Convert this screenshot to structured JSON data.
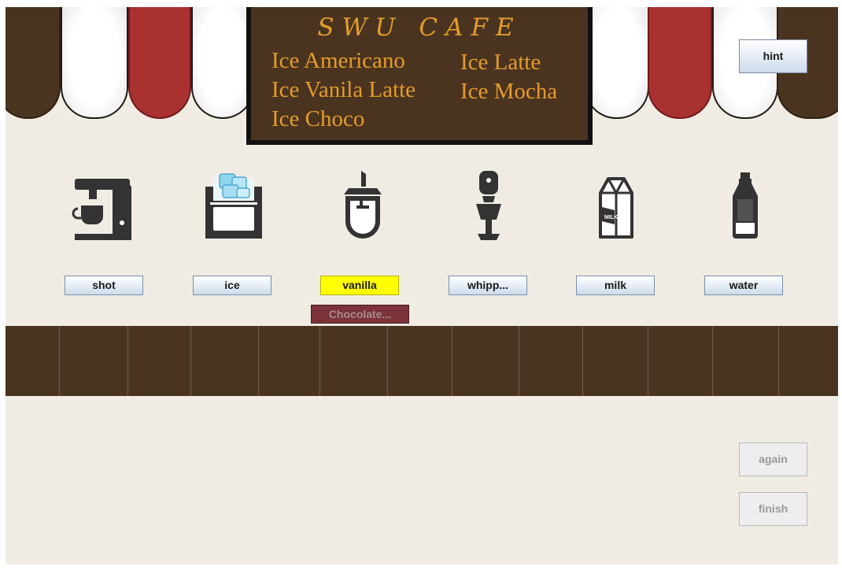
{
  "menu": {
    "title": "SWU CAFE",
    "items": [
      "Ice Americano",
      "Ice Latte",
      "Ice Vanila Latte",
      "Ice Mocha",
      "Ice Choco"
    ]
  },
  "buttons": {
    "hint": "hint",
    "again": "again",
    "finish": "finish",
    "chocolate": "Chocolate..."
  },
  "ingredients": [
    {
      "label": "shot",
      "icon": "espresso-machine-icon",
      "selected": false
    },
    {
      "label": "ice",
      "icon": "ice-machine-icon",
      "selected": false
    },
    {
      "label": "vanilla",
      "icon": "syrup-dispenser-icon",
      "selected": true
    },
    {
      "label": "whipp...",
      "icon": "hand-blender-icon",
      "selected": false
    },
    {
      "label": "milk",
      "icon": "milk-carton-icon",
      "selected": false
    },
    {
      "label": "water",
      "icon": "water-bottle-icon",
      "selected": false
    }
  ],
  "colors": {
    "board": "#4a3420",
    "menu_text": "#e59b2a",
    "awning_red": "#a93130",
    "selected": "#ffff00",
    "chocolate": "#7b3239"
  }
}
